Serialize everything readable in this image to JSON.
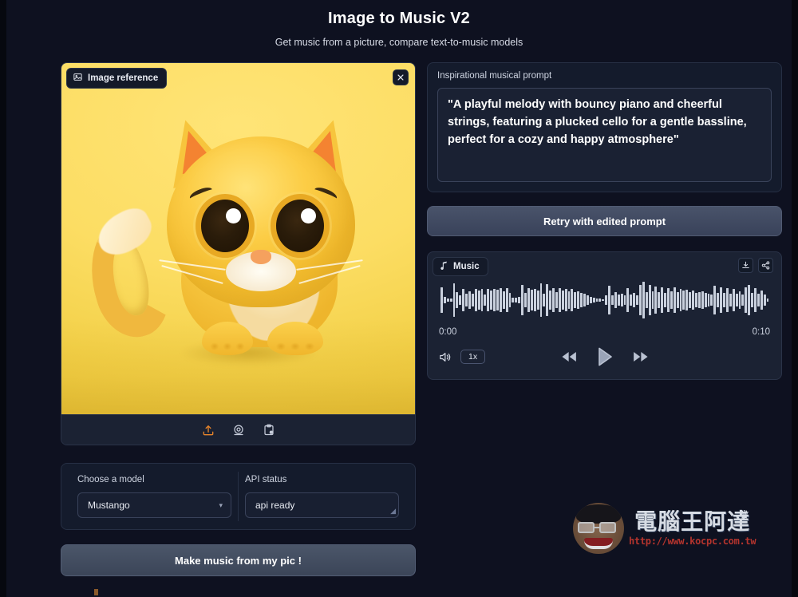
{
  "header": {
    "title": "Image to Music V2",
    "subtitle": "Get music from a picture, compare text-to-music models"
  },
  "image_reference": {
    "tab_label": "Image reference",
    "close_label": "×",
    "icon": "image-icon",
    "toolbar": [
      {
        "name": "upload-icon",
        "label": "Upload"
      },
      {
        "name": "webcam-icon",
        "label": "Webcam"
      },
      {
        "name": "paste-clipboard-icon",
        "label": "Paste from clipboard"
      }
    ]
  },
  "model_section": {
    "model_label": "Choose a model",
    "model_value": "Mustango",
    "api_label": "API status",
    "api_value": "api ready",
    "caret": "▾"
  },
  "actions": {
    "make_music": "Make music from my pic !",
    "retry": "Retry with edited prompt"
  },
  "prompt": {
    "label": "Inspirational musical prompt",
    "value": "\"A playful melody with bouncy piano and cheerful strings, featuring a plucked cello for a gentle bassline, perfect for a cozy and happy atmosphere\"",
    "placeholder": "Inspirational musical prompt"
  },
  "music": {
    "tab_label": "Music",
    "tab_icon": "music-note-icon",
    "download_icon": "download-icon",
    "share_icon": "share-icon",
    "time_current": "0:00",
    "time_total": "0:10",
    "volume_icon": "volume-icon",
    "speed": "1x",
    "rewind_icon": "rewind-icon",
    "play_icon": "play-icon",
    "forward_icon": "fast-forward-icon",
    "waveform": [
      62,
      14,
      6,
      6,
      82,
      40,
      22,
      52,
      32,
      44,
      30,
      52,
      48,
      54,
      28,
      52,
      48,
      54,
      50,
      56,
      44,
      56,
      34,
      12,
      10,
      16,
      72,
      34,
      58,
      50,
      54,
      46,
      80,
      30,
      78,
      46,
      56,
      40,
      58,
      48,
      52,
      44,
      52,
      40,
      44,
      34,
      30,
      22,
      14,
      10,
      8,
      6,
      5,
      22,
      70,
      24,
      40,
      26,
      32,
      22,
      56,
      26,
      34,
      24,
      72,
      88,
      38,
      72,
      44,
      66,
      40,
      62,
      36,
      56,
      44,
      62,
      40,
      54,
      46,
      50,
      40,
      46,
      36,
      40,
      44,
      36,
      30,
      26,
      70,
      36,
      60,
      34,
      58,
      30,
      54,
      32,
      44,
      28,
      62,
      74,
      34,
      58,
      30,
      46,
      26,
      8
    ],
    "colors": {
      "waveform_bar": "#c9d0dd",
      "panel_bg": "#1b2233"
    }
  },
  "watermark": {
    "brand": "電腦王阿達",
    "url": "http://www.kocpc.com.tw",
    "crown": "♛"
  },
  "theme": {
    "background": "#0e1120",
    "panel": "#141b2c",
    "border": "#262f44",
    "accent_upload": "#e8852b",
    "photo_yellow": "#fcdd63"
  }
}
